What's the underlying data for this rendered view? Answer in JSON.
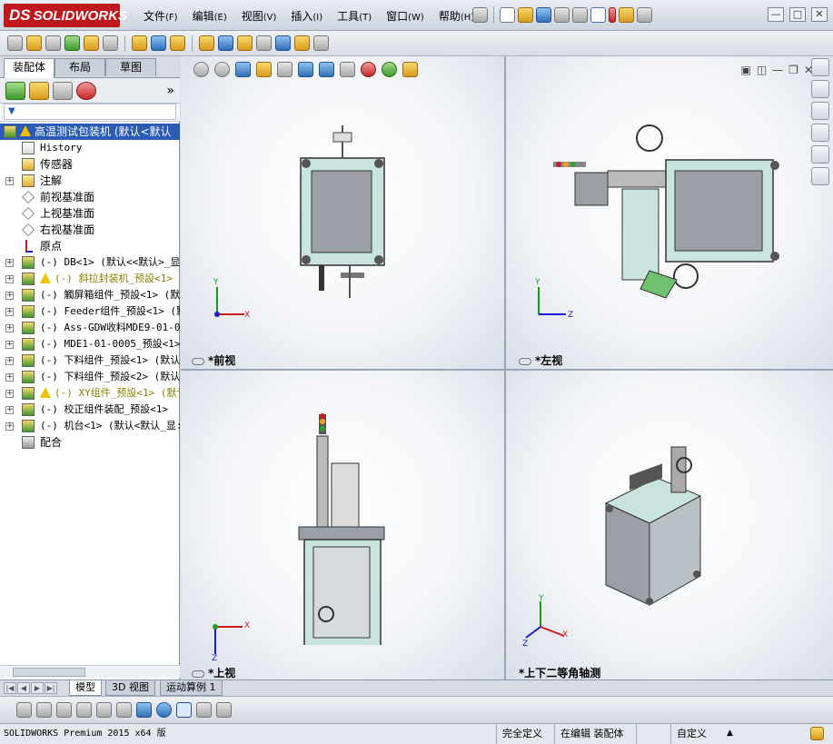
{
  "app": {
    "logo_text": "SOLIDWORKS",
    "logo_prefix": "DS",
    "brand_color": "#c0171c"
  },
  "menu": [
    {
      "label": "文件",
      "key": "(F)"
    },
    {
      "label": "编辑",
      "key": "(E)"
    },
    {
      "label": "视图",
      "key": "(V)"
    },
    {
      "label": "插入",
      "key": "(I)"
    },
    {
      "label": "工具",
      "key": "(T)"
    },
    {
      "label": "窗口",
      "key": "(W)"
    },
    {
      "label": "帮助",
      "key": "(H)"
    }
  ],
  "window_controls": {
    "minimize": "—",
    "restore": "□",
    "close": "✕"
  },
  "feature_manager": {
    "tabs": [
      "装配体",
      "布局",
      "草图"
    ],
    "active_tab": "装配体",
    "expand_symbol": "»",
    "filter_symbol": "▼",
    "tree": [
      {
        "label": "高温测试包装机 (默认<默认",
        "icon": "assembly-icon",
        "warning": true,
        "selected": true,
        "expander": ""
      },
      {
        "label": "History",
        "icon": "history-icon",
        "expander": "",
        "mono": true
      },
      {
        "label": "传感器",
        "icon": "sensor-icon",
        "expander": ""
      },
      {
        "label": "注解",
        "icon": "annotation-icon",
        "expander": "+"
      },
      {
        "label": "前视基准面",
        "icon": "plane-icon",
        "expander": ""
      },
      {
        "label": "上视基准面",
        "icon": "plane-icon",
        "expander": ""
      },
      {
        "label": "右视基准面",
        "icon": "plane-icon",
        "expander": ""
      },
      {
        "label": "原点",
        "icon": "origin-icon",
        "expander": ""
      },
      {
        "label": "(-) DB<1> (默认<<默认>_显:",
        "icon": "subassembly-icon",
        "expander": "+",
        "mono": true
      },
      {
        "label": "(-) 斜拉封装机_预設<1>",
        "icon": "subassembly-icon",
        "warning": true,
        "expander": "+",
        "mono": true,
        "warn_color": true
      },
      {
        "label": "(-) 觸屏箱组件_预設<1> (默",
        "icon": "subassembly-icon",
        "expander": "+",
        "mono": true
      },
      {
        "label": "(-) Feeder组件_预設<1> (默",
        "icon": "subassembly-icon",
        "expander": "+",
        "mono": true
      },
      {
        "label": "(-) Ass-GDW收料MDE9-01-000",
        "icon": "subassembly-icon",
        "expander": "+",
        "mono": true
      },
      {
        "label": "(-) MDE1-01-0005_预設<1>",
        "icon": "subassembly-icon",
        "expander": "+",
        "mono": true
      },
      {
        "label": "(-) 下料组件_预設<1> (默认",
        "icon": "subassembly-icon",
        "expander": "+",
        "mono": true
      },
      {
        "label": "(-) 下料组件_预設<2> (默认",
        "icon": "subassembly-icon",
        "expander": "+",
        "mono": true
      },
      {
        "label": "(-) XY组件_预設<1> (默讠",
        "icon": "subassembly-icon",
        "warning": true,
        "expander": "+",
        "mono": true,
        "warn_color": true
      },
      {
        "label": "(-) 校正组件装配_预設<1>",
        "icon": "subassembly-icon",
        "expander": "+",
        "mono": true
      },
      {
        "label": "(-) 机台<1> (默认<默认_显:",
        "icon": "subassembly-icon",
        "expander": "+",
        "mono": true
      },
      {
        "label": "配合",
        "icon": "mates-icon",
        "expander": ""
      }
    ]
  },
  "viewports": [
    {
      "name": "前视",
      "prefix": "*",
      "axes": [
        "Y",
        "X"
      ]
    },
    {
      "name": "左视",
      "prefix": "*",
      "axes": [
        "Y",
        "Z"
      ]
    },
    {
      "name": "上视",
      "prefix": "*",
      "axes": [
        "X",
        "Z"
      ]
    },
    {
      "name": "上下二等角轴测",
      "prefix": "*",
      "axes": [
        "Y",
        "X",
        "Z"
      ]
    }
  ],
  "bottom_tabs": [
    "模型",
    "3D 视图",
    "运动算例 1"
  ],
  "active_bottom_tab": "模型",
  "nav_arrows": [
    "|◀",
    "◀",
    "▶",
    "▶|"
  ],
  "status": {
    "product": "SOLIDWORKS Premium 2015 x64 版",
    "definition": "完全定义",
    "editing": "在编辑 装配体",
    "units": "自定义",
    "arrow": "▲"
  }
}
